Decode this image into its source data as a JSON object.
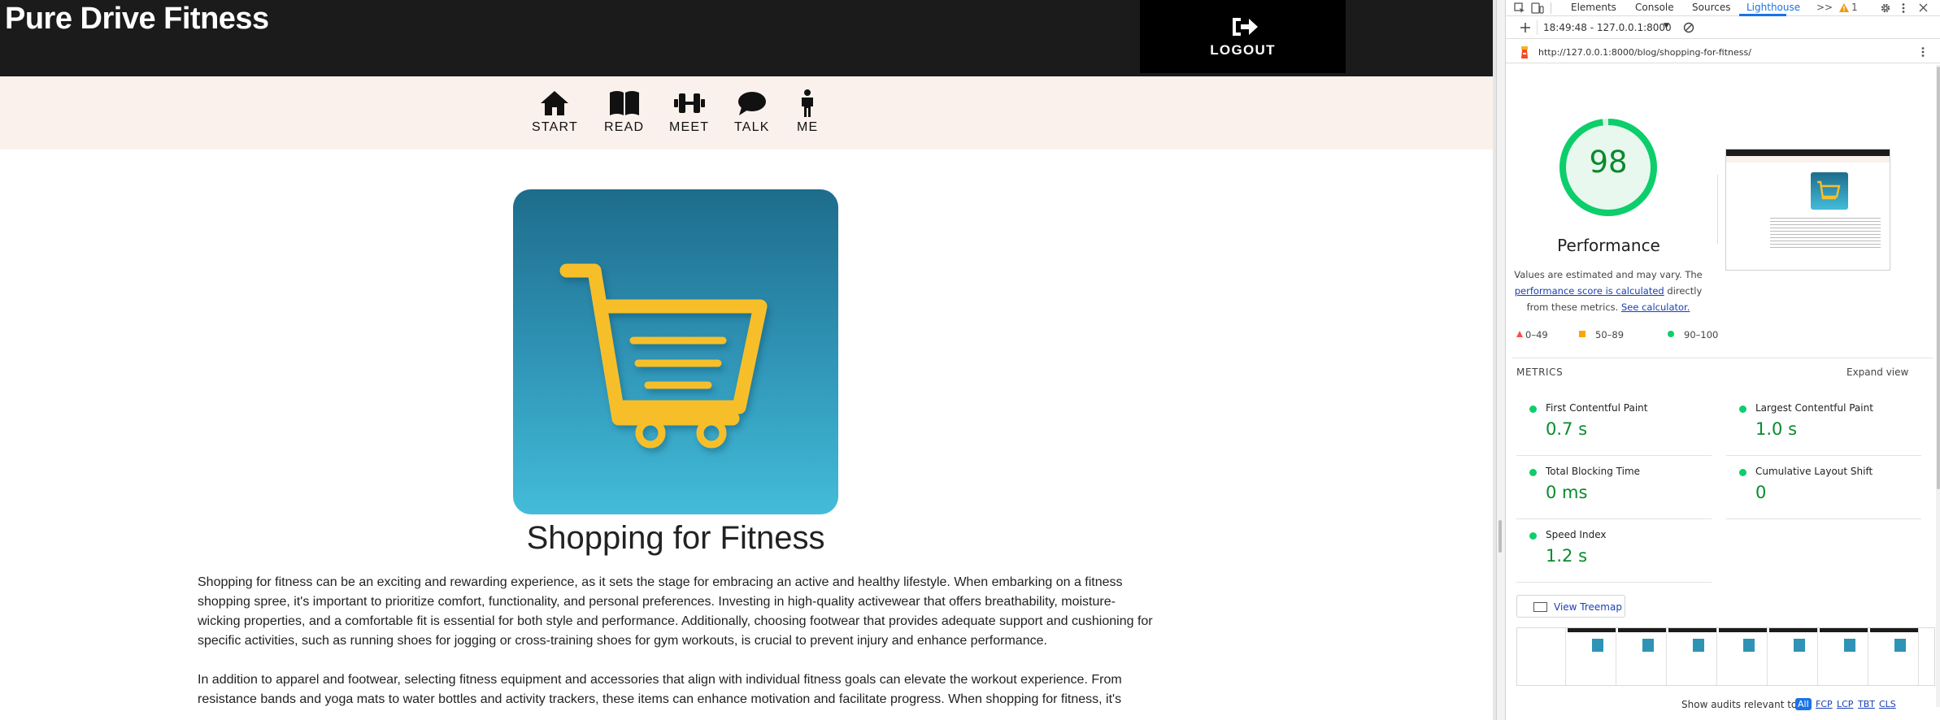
{
  "site": {
    "brand": "Pure Drive Fitness",
    "logout_label": "LOGOUT",
    "nav": [
      {
        "label": "START",
        "icon": "home-icon"
      },
      {
        "label": "READ",
        "icon": "book-icon"
      },
      {
        "label": "MEET",
        "icon": "dumbbell-icon"
      },
      {
        "label": "TALK",
        "icon": "chat-icon"
      },
      {
        "label": "ME",
        "icon": "person-icon"
      }
    ],
    "hero_icon": "shopping-cart-icon",
    "post_title": "Shopping for Fitness",
    "paragraphs": [
      "Shopping for fitness can be an exciting and rewarding experience, as it sets the stage for embracing an active and healthy lifestyle. When embarking on a fitness shopping spree, it's important to prioritize comfort, functionality, and personal preferences. Investing in high-quality activewear that offers breathability, moisture-wicking properties, and a comfortable fit is essential for both style and performance. Additionally, choosing footwear that provides adequate support and cushioning for specific activities, such as running shoes for jogging or cross-training shoes for gym workouts, is crucial to prevent injury and enhance performance.",
      "In addition to apparel and footwear, selecting fitness equipment and accessories that align with individual fitness goals can elevate the workout experience. From resistance bands and yoga mats to water bottles and activity trackers, these items can enhance motivation and facilitate progress. When shopping for fitness, it's"
    ],
    "colors": {
      "header": "#1b1b1b",
      "nav_bg": "#fbf1ec",
      "cart": "#f6bf2b"
    }
  },
  "devtools": {
    "tabs": [
      "Elements",
      "Console",
      "Sources",
      "Lighthouse"
    ],
    "active_tab": "Lighthouse",
    "more_tabs": ">>",
    "warning_count": "1",
    "report_selector": "18:49:48 - 127.0.0.1:8000",
    "url": "http://127.0.0.1:8000/blog/shopping-for-fitness/",
    "score": "98",
    "score_value": 0.98,
    "category": "Performance",
    "note_prefix": "Values are estimated and may vary. The",
    "note_link": "performance score is calculated",
    "note_mid": "directly from these metrics.",
    "note_link2": "See calculator.",
    "legend": [
      "0–49",
      "50–89",
      "90–100"
    ],
    "metrics_heading": "METRICS",
    "expand_view": "Expand view",
    "metrics": [
      {
        "name": "First Contentful Paint",
        "value": "0.7 s"
      },
      {
        "name": "Largest Contentful Paint",
        "value": "1.0 s"
      },
      {
        "name": "Total Blocking Time",
        "value": "0 ms"
      },
      {
        "name": "Cumulative Layout Shift",
        "value": "0"
      },
      {
        "name": "Speed Index",
        "value": "1.2 s"
      }
    ],
    "treemap_label": "View Treemap",
    "audits_label": "Show audits relevant to:",
    "audit_filters": [
      "All",
      "FCP",
      "LCP",
      "TBT",
      "CLS"
    ],
    "colors": {
      "pass": "#0cce6b",
      "average": "#ffa400",
      "fail": "#ff4e42",
      "accent": "#1a73e8"
    }
  }
}
